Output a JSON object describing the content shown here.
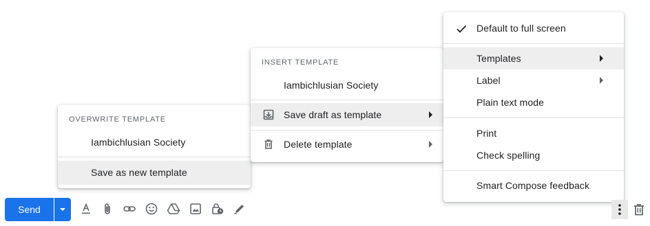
{
  "left_menu": {
    "header": "OVERWRITE TEMPLATE",
    "items": [
      "Iambichlusian Society",
      "Save as new template"
    ]
  },
  "middle_menu": {
    "header": "INSERT TEMPLATE",
    "template_item": "Iambichlusian Society",
    "save_draft": "Save draft as template",
    "delete": "Delete template"
  },
  "right_menu": {
    "default_full_screen": "Default to full screen",
    "templates": "Templates",
    "label": "Label",
    "plain_text": "Plain text mode",
    "print": "Print",
    "check_spelling": "Check spelling",
    "smart_compose": "Smart Compose feedback"
  },
  "toolbar": {
    "send_label": "Send"
  },
  "icons": {
    "send_options": "chevron-down-icon",
    "format": "text-format-icon",
    "attach": "attach-icon",
    "link": "link-icon",
    "emoji": "emoji-icon",
    "drive": "drive-icon",
    "photo": "photo-icon",
    "confidential": "lock-clock-icon",
    "signature": "signature-pen-icon",
    "more": "more-vert-icon",
    "discard": "trash-icon"
  },
  "colors": {
    "accent": "#1a73e8",
    "highlight": "#eeeeee"
  }
}
